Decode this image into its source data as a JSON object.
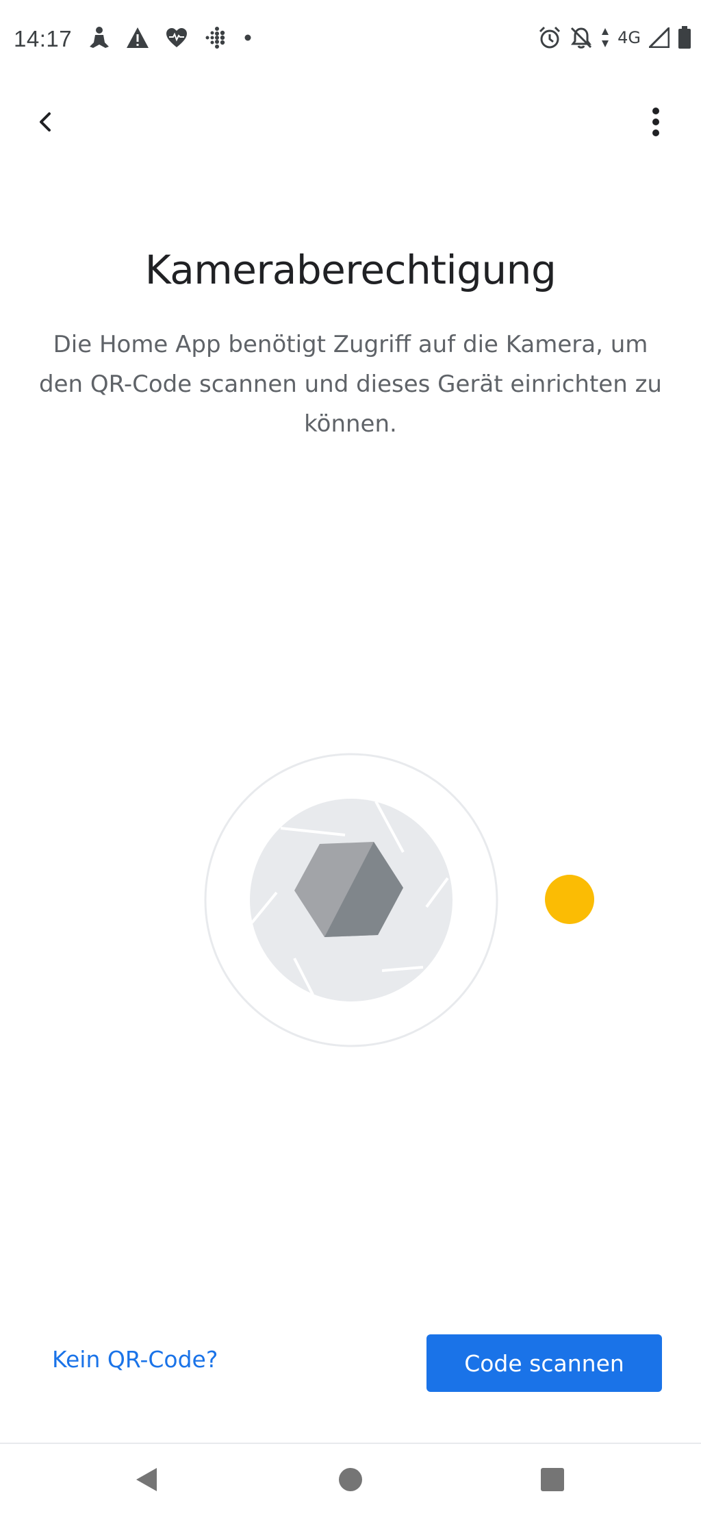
{
  "status_bar": {
    "time": "14:17",
    "left_icons": [
      "meditation-icon",
      "warning-icon",
      "heart-rate-icon",
      "fitbit-icon",
      "notification-dot-icon"
    ],
    "right_icons": [
      "alarm-icon",
      "notifications-off-icon",
      "data-arrows-icon",
      "signal-icon",
      "battery-icon"
    ],
    "network_label": "4G"
  },
  "app_bar": {
    "back_icon": "chevron-left-icon",
    "menu_icon": "more-vert-icon"
  },
  "content": {
    "title": "Kameraberechtigung",
    "description": "Die Home App benötigt Zugriff auf die Kamera, um den QR-Code scannen und dieses Gerät einrichten zu können."
  },
  "illustration": {
    "icon": "camera-shutter-icon",
    "accent_color": "#fbbc04"
  },
  "actions": {
    "secondary_label": "Kein QR-Code?",
    "primary_label": "Code scannen",
    "primary_color": "#1a73e8"
  },
  "nav_bar": {
    "icons": [
      "nav-back-icon",
      "nav-home-icon",
      "nav-recents-icon"
    ]
  }
}
